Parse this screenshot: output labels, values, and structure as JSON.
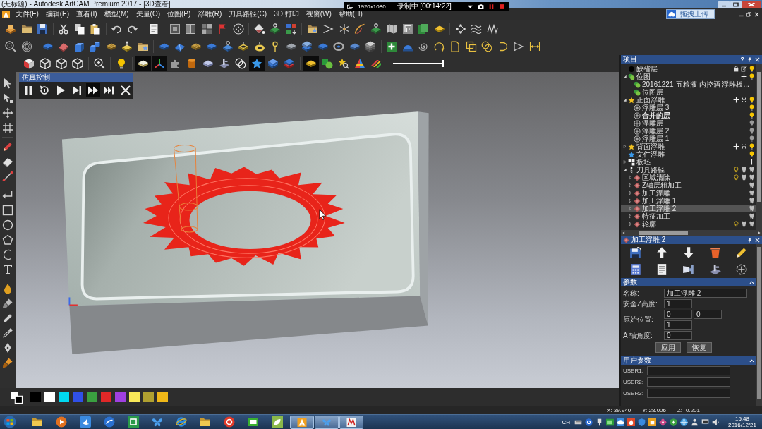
{
  "window": {
    "title": "(无标题) - Autodesk ArtCAM Premium 2017 - [3D查看]"
  },
  "recorder": {
    "resolution": "1920x1080",
    "status": "录制中 [00:14:22]"
  },
  "menu": [
    "文件(F)",
    "编辑(E)",
    "查看(I)",
    "模型(M)",
    "矢量(O)",
    "位图(P)",
    "浮雕(R)",
    "刀具路径(C)",
    "3D 打印",
    "视窗(W)",
    "帮助(H)"
  ],
  "upload_button": {
    "label": "拖拽上传"
  },
  "view_toolbar": {
    "buttons": [
      {
        "pressed": false
      },
      {
        "pressed": false
      },
      {
        "pressed": false
      },
      {
        "pressed": false
      },
      {
        "pressed": false
      },
      {
        "pressed": false
      },
      {
        "pressed": true
      },
      {
        "pressed": true
      },
      {
        "pressed": false
      },
      {
        "pressed": false
      },
      {
        "pressed": false
      },
      {
        "pressed": false
      },
      {
        "pressed": false
      },
      {
        "pressed": true
      },
      {
        "pressed": false
      },
      {
        "pressed": false
      },
      {
        "pressed": true
      },
      {
        "pressed": false
      },
      {
        "pressed": false
      },
      {
        "pressed": false
      },
      {
        "pressed": false
      }
    ],
    "slider": {
      "level": 1
    }
  },
  "sim_control": {
    "title": "仿真控制",
    "buttons": [
      {
        "pressed": false
      },
      {
        "pressed": false
      },
      {
        "pressed": false
      },
      {
        "pressed": false
      },
      {
        "pressed": true
      },
      {
        "pressed": false
      },
      {
        "pressed": false
      }
    ]
  },
  "palette": [
    {
      "color": "#000000"
    },
    {
      "color": "#ffffff"
    },
    {
      "color": "#00d8f0"
    },
    {
      "color": "#3050e8"
    },
    {
      "color": "#3aa040"
    },
    {
      "color": "#e02828"
    },
    {
      "color": "#a040e0"
    },
    {
      "color": "#f8e858"
    },
    {
      "color": "#b0a030"
    },
    {
      "color": "#f0b818"
    }
  ],
  "project_panel": {
    "title": "项目",
    "help": "?",
    "tree": [
      {
        "label": "缺省层",
        "kind": "default_layer",
        "selected": false,
        "visible": true
      },
      {
        "label": "位图",
        "kind": "bitmap_group",
        "expanded": true,
        "selected": false,
        "visible": true,
        "children": [
          {
            "label": "20161221-五粮液 内控酒 浮雕板...",
            "kind": "bitmap",
            "selected": false
          },
          {
            "label": "位图层",
            "kind": "bitmap",
            "selected": false
          }
        ]
      },
      {
        "label": "正面浮雕",
        "kind": "relief_group",
        "expanded": true,
        "selected": false,
        "visible": true,
        "children": [
          {
            "label": "浮雕层 3",
            "kind": "relief_layer",
            "selected": false,
            "active": false,
            "visible": true
          },
          {
            "label": "合并的层",
            "kind": "merged_layer",
            "selected": false,
            "active": true,
            "visible": true
          },
          {
            "label": "浮雕层",
            "kind": "grid_layer",
            "selected": false,
            "active": false,
            "visible": false
          },
          {
            "label": "浮雕层 2",
            "kind": "relief_layer",
            "selected": false,
            "active": false,
            "visible": false
          },
          {
            "label": "浮雕层 1",
            "kind": "relief_layer",
            "selected": false,
            "active": false,
            "visible": false
          }
        ]
      },
      {
        "label": "背面浮雕",
        "kind": "relief_group",
        "expanded": false,
        "selected": false,
        "visible": true
      },
      {
        "label": "文件浮雕",
        "kind": "file_relief",
        "selected": false,
        "visible": true
      },
      {
        "label": "板坯",
        "kind": "blank",
        "expanded": false,
        "selected": false
      },
      {
        "label": "刀具路径",
        "kind": "toolpath_group",
        "expanded": true,
        "selected": false,
        "visible": true,
        "children": [
          {
            "label": "区域清除",
            "kind": "toolpath",
            "expanded": false,
            "selected": false,
            "visible": true
          },
          {
            "label": "Z轴层粗加工",
            "kind": "toolpath",
            "expanded": false,
            "selected": false,
            "visible": false
          },
          {
            "label": "加工浮雕",
            "kind": "toolpath",
            "expanded": false,
            "selected": false,
            "visible": false
          },
          {
            "label": "加工浮雕 1",
            "kind": "toolpath",
            "expanded": false,
            "selected": false,
            "visible": false
          },
          {
            "label": "加工浮雕 2",
            "kind": "toolpath",
            "expanded": false,
            "selected": true,
            "visible": false
          },
          {
            "label": "特征加工",
            "kind": "toolpath",
            "expanded": false,
            "selected": false,
            "visible": false
          },
          {
            "label": "轮廓",
            "kind": "toolpath",
            "expanded": false,
            "selected": false,
            "visible": true
          }
        ]
      }
    ]
  },
  "toolpath_panel": {
    "title": "加工浮雕 2",
    "params": {
      "title": "参数",
      "expanded": true,
      "fields": [
        {
          "label": "名称:",
          "values": [
            "加工浮雕 2"
          ]
        },
        {
          "label": "安全Z高度:",
          "values": [
            "1"
          ]
        },
        {
          "label": "原始位置:",
          "values": [
            "0",
            "0",
            "1"
          ]
        },
        {
          "label": "A 轴角度:",
          "values": [
            "0"
          ]
        }
      ],
      "buttons": [
        "应用",
        "恢复"
      ]
    },
    "user_params": {
      "title": "用户参数",
      "expanded": true,
      "fields": [
        "USER1:",
        "USER2:",
        "USER3:"
      ]
    }
  },
  "status_bar": {
    "x": "X: 39.940",
    "y": "Y: 28.006",
    "z": "Z: -0.201"
  },
  "taskbar": {
    "apps": [
      {
        "running": false
      },
      {
        "running": false
      },
      {
        "running": false
      },
      {
        "running": false
      },
      {
        "running": false
      },
      {
        "running": false
      },
      {
        "running": false
      },
      {
        "running": false
      },
      {
        "running": false
      },
      {
        "running": false
      },
      {
        "running": false
      },
      {
        "running": true
      },
      {
        "running": true
      },
      {
        "running": true
      }
    ],
    "language": "CH",
    "time": "15:48",
    "date": "2016/12/21"
  }
}
